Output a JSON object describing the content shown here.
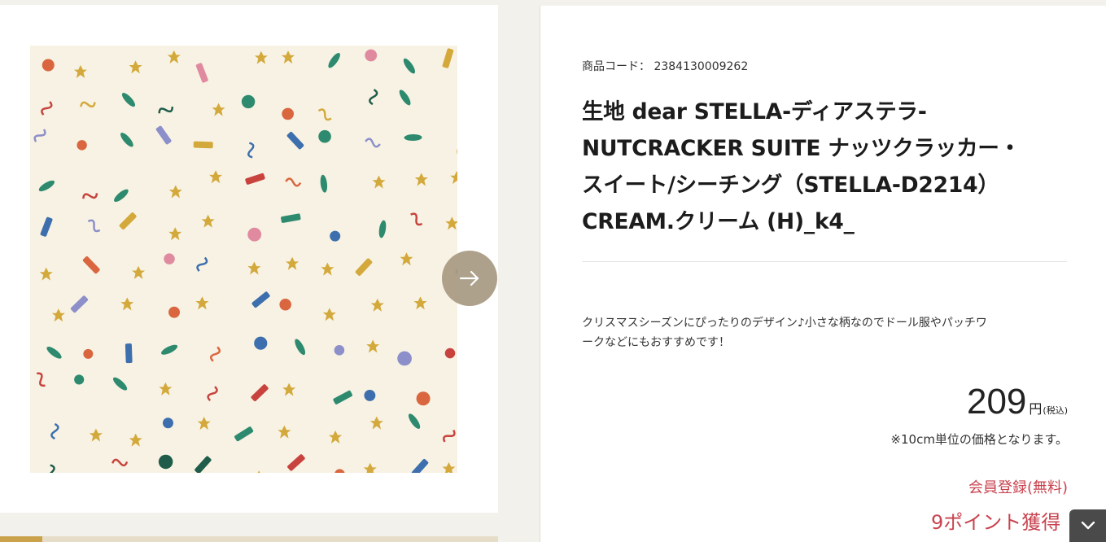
{
  "product": {
    "code_label": "商品コード：",
    "code_value": "2384130009262",
    "title_line1": "生地 dear STELLA-ディアステラ-",
    "title_line2": "NUTCRACKER SUITE ナッツクラッカー・",
    "title_line3": "スイート/シーチング（STELLA-D2214）",
    "title_line4": "CREAM.クリーム (H)_k4_",
    "description_line1": "クリスマスシーズンにぴったりのデザイン♪小さな柄なのでドール服やパッチワ",
    "description_line2": "ークなどにもおすすめです！"
  },
  "price": {
    "value": "209",
    "unit": "円",
    "tax": "(税込)",
    "note": "※10cm単位の価格となります。"
  },
  "links": {
    "register": "会員登録(無料)",
    "points": "9ポイント獲得"
  },
  "icons": {
    "next": "arrow-right-icon",
    "scroll": "chevron-down-icon"
  },
  "colors": {
    "accent_red": "#c8434f",
    "arrow_button": "#a89a82",
    "fabric_background": "#f7f2e3"
  }
}
